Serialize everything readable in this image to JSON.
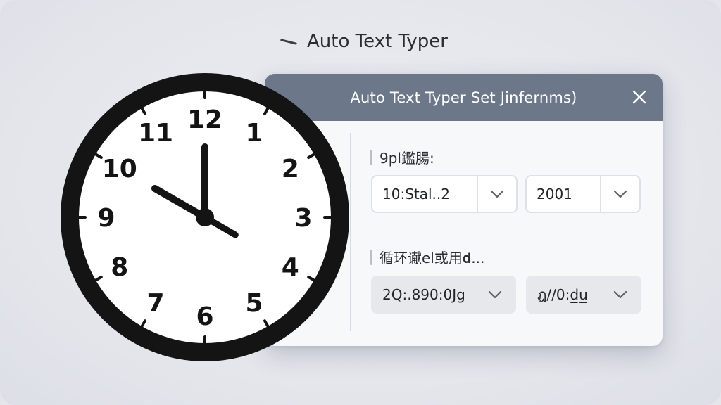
{
  "app": {
    "title": "Auto Text Typer"
  },
  "dialog": {
    "title": "Auto Text Typer Set Jinfernms)",
    "section1": {
      "label": "9pl鑑腸:",
      "select1_value": "10:Stal..2",
      "select2_value": "2001"
    },
    "section2": {
      "label": "循环谳el或用𝐝...",
      "select1_value": "2Q:.890:0Jg",
      "select2_value": "ฎ//0:d̲u̲"
    }
  },
  "clock": {
    "numerals": [
      "12",
      "1",
      "2",
      "3",
      "4",
      "5",
      "6",
      "7",
      "8",
      "9",
      "10",
      "11"
    ],
    "time_hour": 10,
    "time_minute": 0
  },
  "colors": {
    "header": "#6c7889",
    "clock_ring": "#141414",
    "clock_face": "#ffffff"
  },
  "icons": {
    "title_mark": "dash-icon",
    "close": "close-icon",
    "dropdown": "chevron-down-icon"
  }
}
